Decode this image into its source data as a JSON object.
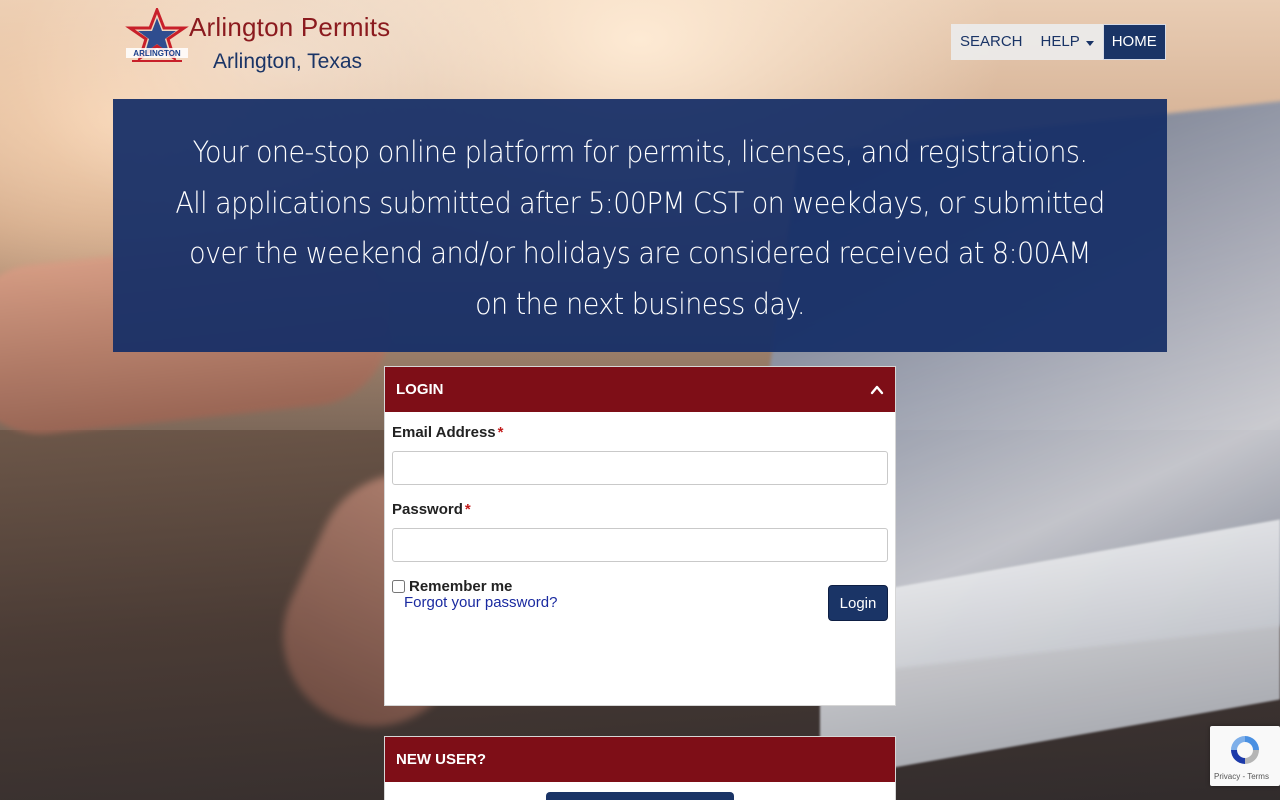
{
  "header": {
    "title": "Arlington Permits",
    "subtitle": "Arlington, Texas",
    "logo_icon": "arlington-star-logo"
  },
  "nav": {
    "items": [
      {
        "label": "SEARCH"
      },
      {
        "label": "HELP",
        "has_dropdown": true
      },
      {
        "label": "HOME",
        "active": true
      }
    ]
  },
  "banner": {
    "line1": "Your one-stop online platform for permits, licenses, and registrations.",
    "line2": "All applications submitted after 5:00PM CST on weekdays, or submitted over the weekend and/or holidays are considered received at 8:00AM on the next business day."
  },
  "login_panel": {
    "heading": "LOGIN",
    "collapse_icon": "chevron-up-icon",
    "email_label": "Email Address",
    "email_value": "",
    "password_label": "Password",
    "password_value": "",
    "required_mark": "*",
    "remember_label": "Remember me",
    "remember_checked": false,
    "forgot_label": "Forgot your password?",
    "login_button": "Login"
  },
  "new_user_panel": {
    "heading": "NEW USER?"
  },
  "recaptcha": {
    "terms": "Privacy - Terms"
  },
  "colors": {
    "brand_red": "#7e0e17",
    "brand_navy": "#1a3466",
    "banner_bg": "#162f67"
  }
}
